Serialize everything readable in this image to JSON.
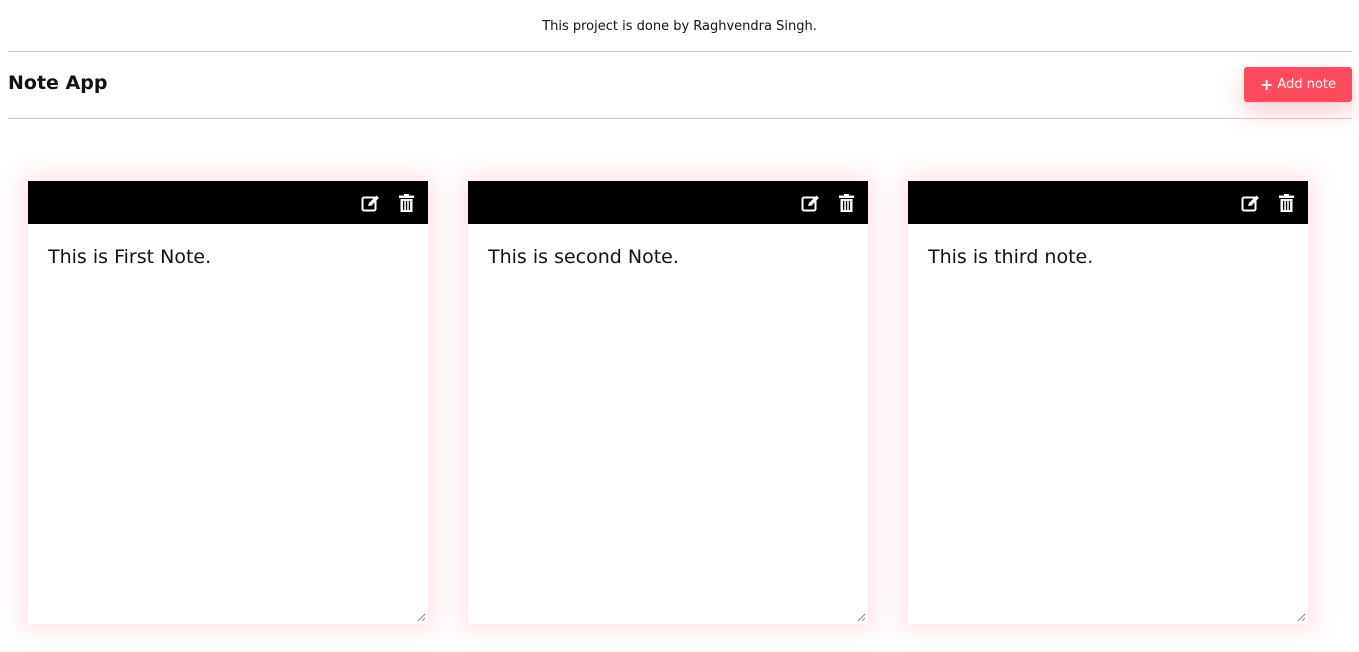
{
  "footer_credit": "This project is done by Raghvendra Singh.",
  "header": {
    "title": "Note App",
    "add_button_label": "Add note"
  },
  "colors": {
    "accent": "#ff4b5c",
    "toolbar": "#000000"
  },
  "notes": [
    {
      "text": "This is First Note.",
      "icons": [
        "edit-icon",
        "trash-icon"
      ]
    },
    {
      "text": "This is second Note.",
      "icons": [
        "edit-icon",
        "trash-icon"
      ]
    },
    {
      "text": "This is third note.",
      "icons": [
        "edit-icon",
        "trash-icon"
      ]
    }
  ]
}
